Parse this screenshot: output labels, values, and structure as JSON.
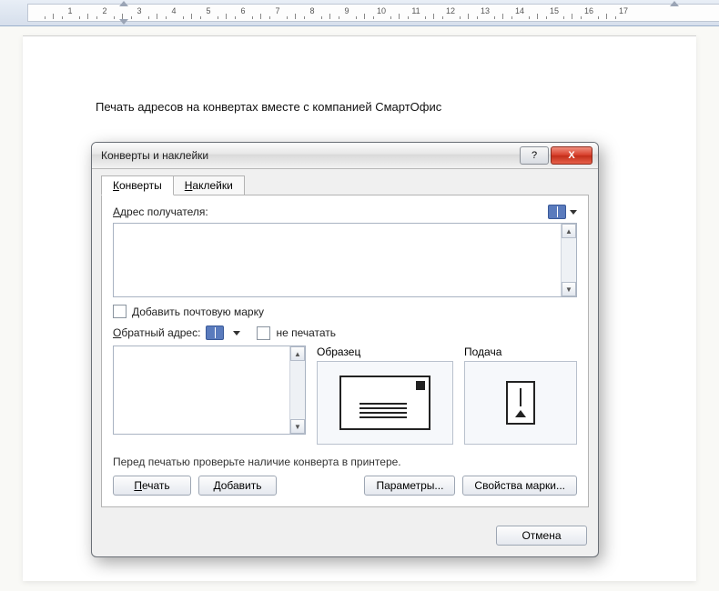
{
  "ruler": {
    "max_cm": 17
  },
  "document": {
    "heading": "Печать адресов на конвертах вместе с компанией СмартОфис"
  },
  "dialog": {
    "title": "Конверты и наклейки",
    "help_glyph": "?",
    "close_glyph": "X",
    "tabs": {
      "envelopes": "Конверты",
      "labels": "Наклейки",
      "active": "envelopes"
    },
    "recipient": {
      "label": "Адрес получателя:",
      "value": ""
    },
    "add_postage": {
      "label": "Добавить почтовую марку",
      "checked": false
    },
    "return_address": {
      "label": "Обратный адрес:",
      "no_print_label": "не печатать",
      "no_print_checked": false,
      "value": ""
    },
    "preview": {
      "label": "Образец"
    },
    "feed": {
      "label": "Подача"
    },
    "checkHint": "Перед печатью проверьте наличие конверта в принтере.",
    "buttons": {
      "print": "Печать",
      "add": "Добавить",
      "options": "Параметры...",
      "postage_props": "Свойства марки..."
    },
    "footer": {
      "cancel": "Отмена"
    }
  }
}
